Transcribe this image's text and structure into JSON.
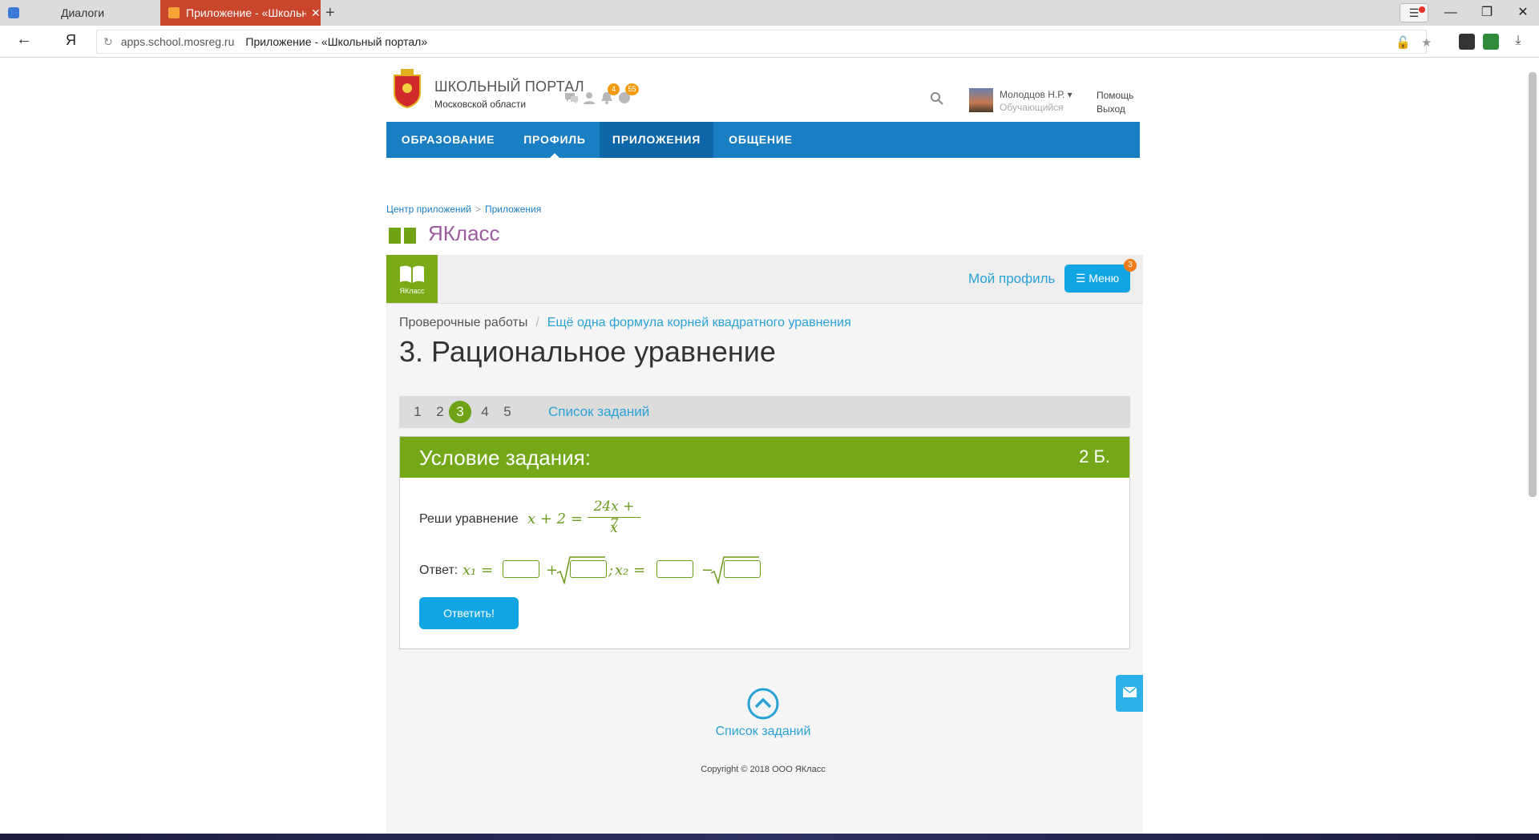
{
  "browser": {
    "tabs": [
      {
        "title": "Диалоги",
        "active": false
      },
      {
        "title": "Приложение - «Школьный портал»",
        "active": true
      }
    ],
    "new_tab": "+",
    "address": {
      "host": "apps.school.mosreg.ru",
      "title": "Приложение - «Школьный портал»"
    },
    "back": "←",
    "yandex": "Я",
    "reload": "↻"
  },
  "portal": {
    "brand_line1": "ШКОЛЬНЫЙ ПОРТАЛ",
    "brand_line2": "Московской области",
    "badges": {
      "notifications": "4",
      "world": "55"
    },
    "user": {
      "name": "Молодцов Н.Р.",
      "role": "Обучающийся"
    },
    "help": "Помощь",
    "logout": "Выход",
    "nav": [
      {
        "label": "ОБРАЗОВАНИЕ"
      },
      {
        "label": "ПРОФИЛЬ"
      },
      {
        "label": "ПРИЛОЖЕНИЯ"
      },
      {
        "label": "ОБЩЕНИЕ"
      }
    ],
    "breadcrumbs": [
      "Центр приложений",
      "Приложения"
    ],
    "app_title": "ЯКласс"
  },
  "yaklass": {
    "logo_text": "ЯКласс",
    "my_profile": "Мой профиль",
    "menu_label": "Меню",
    "menu_badge": "3",
    "breadcrumb": {
      "root": "Проверочные работы",
      "separator": "/",
      "link": "Ещё одна формула корней квадратного уравнения"
    },
    "page_title": "3. Рациональное уравнение",
    "pager": {
      "pages": [
        "1",
        "2",
        "3",
        "4",
        "5"
      ],
      "current": "3",
      "list_label": "Список заданий"
    },
    "task": {
      "header": "Условие задания:",
      "points": "2 Б.",
      "question_label": "Реши уравнение",
      "equation_lhs": "x + 2 =",
      "frac_num": "24x + 7",
      "frac_den": "x",
      "answer_label": "Ответ:",
      "x1": "x₁ =",
      "plus": "+",
      "semicolon": ";",
      "x2": "x₂ =",
      "minus": "−",
      "submit": "Ответить!"
    },
    "footer": {
      "back_to_list": "Список заданий",
      "copyright": "Copyright © 2018 ООО ЯКласс"
    }
  },
  "colors": {
    "nav": "#1a7ec2",
    "green": "#75a819",
    "accent_blue": "#11a5e4",
    "title_purple": "#9d5ba0"
  }
}
